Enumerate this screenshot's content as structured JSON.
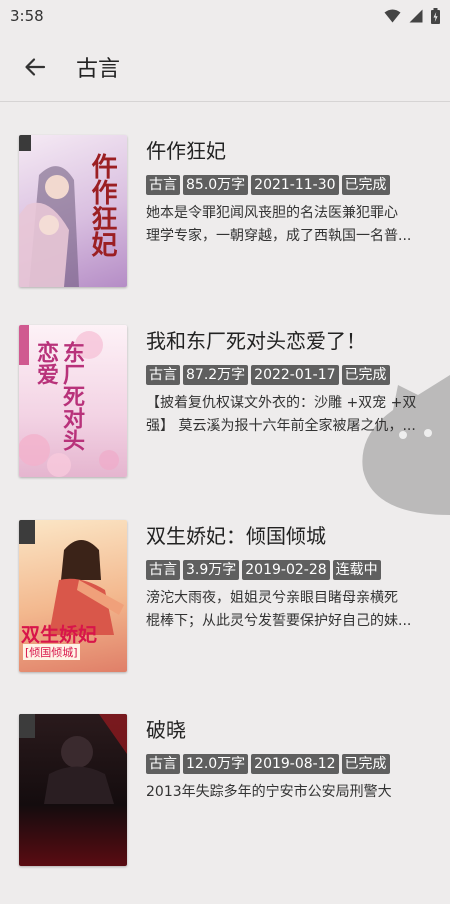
{
  "status_bar": {
    "time": "3:58"
  },
  "app_bar": {
    "title": "古言"
  },
  "books": [
    {
      "title": "仵作狂妃",
      "tags": [
        "古言",
        "85.0万字",
        "2021-11-30",
        "已完成"
      ],
      "desc_line1": "她本是令罪犯闻风丧胆的名法医兼犯罪心",
      "desc_line2": "理学专家，一朝穿越，成了西執国一名普...",
      "cover_title": "仵作狂妃",
      "cover_colors": [
        "#f3e4f2",
        "#c9a6d8"
      ]
    },
    {
      "title": "我和东厂死对头恋爱了！",
      "tags": [
        "古言",
        "87.2万字",
        "2022-01-17",
        "已完成"
      ],
      "desc_line1": "【披着复仇权谋文外衣的：沙雕 +双宠 +双",
      "desc_line2": "强】 莫云溪为报十六年前全家被屠之仇，...",
      "cover_title": "东厂死对头恋爱",
      "cover_colors": [
        "#fbeaf2",
        "#e7b8d4"
      ]
    },
    {
      "title": "双生娇妃：倾国倾城",
      "tags": [
        "古言",
        "3.9万字",
        "2019-02-28",
        "连载中"
      ],
      "desc_line1": "滂沱大雨夜，姐姐灵兮亲眼目睹母亲横死",
      "desc_line2": "棍棒下；从此灵兮发誓要保护好自己的妹...",
      "cover_title": "双生娇妃",
      "cover_sub": "[倾国倾城]",
      "cover_colors": [
        "#f6d4a8",
        "#e58d6c"
      ]
    },
    {
      "title": "破晓",
      "tags": [
        "古言",
        "12.0万字",
        "2019-08-12",
        "已完成"
      ],
      "desc_line1": "2013年失踪多年的宁安市公安局刑警大",
      "desc_line2": "",
      "cover_colors": [
        "#1a1012",
        "#8a1016"
      ]
    }
  ]
}
